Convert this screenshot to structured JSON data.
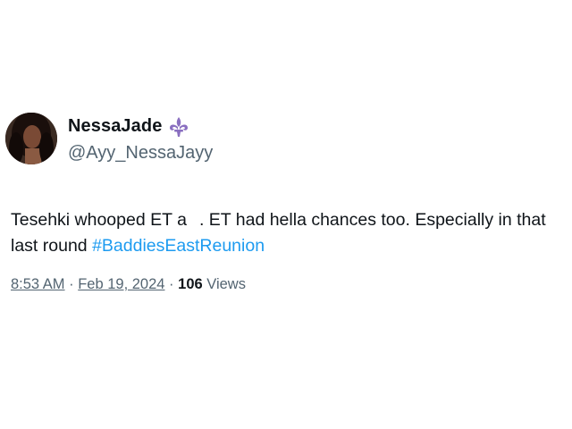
{
  "tweet": {
    "display_name": "NessaJade",
    "handle": "@Ayy_NessaJayy",
    "badge_icon": "fleur-de-lis-icon",
    "badge_color": "#8a6fc0",
    "text_line1_a": "Tesehki whooped ET a",
    "text_line1_b": ". ET had hella chances too. Especially in that",
    "text_line2": "last round ",
    "hashtag": "#BaddiesEastReunion",
    "time": "8:53 AM",
    "sep1": " · ",
    "date": "Feb 19, 2024",
    "sep2": " · ",
    "views_count": "106",
    "views_label": " Views",
    "accent_color": "#1d9bf0"
  }
}
